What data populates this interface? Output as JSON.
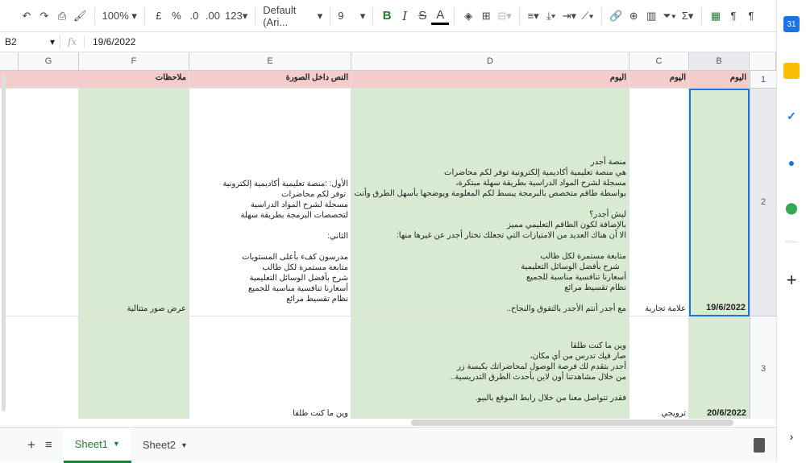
{
  "toolbar": {
    "zoom": "100%",
    "currency": "£",
    "percent": "%",
    "dec_less": ".0",
    "dec_more": ".00",
    "format": "123",
    "font": "Default (Ari...",
    "size": "9",
    "bold": "B",
    "italic": "I",
    "strike": "S",
    "textcolor": "A"
  },
  "formula": {
    "cell": "B2",
    "fx": "fx",
    "value": "19/6/2022"
  },
  "columns": [
    "G",
    "F",
    "E",
    "D",
    "C",
    "B"
  ],
  "rows": [
    "1",
    "2",
    "3"
  ],
  "header": {
    "F": "ملاحظات",
    "E": "النص داخل الصورة",
    "D": "اليوم",
    "C": "اليوم",
    "B": "اليوم"
  },
  "row2": {
    "B": "19/6/2022",
    "C": "علامة تجارية",
    "D": "منصة أجدر\nهي منصة تعليمية أكاديمية إلكترونية توفر لكم محاضرات\nمسجلة لشرح المواد الدراسية بطريقة سهلة مبتكرة،\nبواسطة طاقم متخصص بالبرمجة يبسط لكم المعلومة ويوضحها بأسهل الطرق وأنت في مكانك.\n\nليش أجدر؟\nبالإضافة لكون الطاقم التعليمي مميز\nالا أن هناك العديد من الامتيازات التي تجعلك تختار أجدر عن غيرها منها:\n\nمتابعة مستمرة لكل طالب\n   شرح بأفضل الوسائل التعليمية\nأسعارنا تنافسية مناسبة للجميع\nنظام تقسيط مرائع\n\nمع أجدر أنتم الأجدر بالتفوق والنجاح..",
    "E": "الأول: :منصة تعليمية أكاديمية إلكترونية\n توفر لكم محاضرات\nمسجلة لشرح المواد الدراسية\nلتخصصات البرمجة بطريقة سهلة\n\nالثاني:\n\nمدرسون كفء بأعلى المستويات\nمتابعة مستمرة لكل طالب\nشرح بأفضل الوسائل التعليمية\nأسعارنا تنافسية مناسبة للجميع\nنظام تقسيط مرائع",
    "F": "عرض صور متتالية"
  },
  "row3": {
    "B": "20/6/2022",
    "C": "ترويجي",
    "D": "وين ما كنت طلقا\nصار فيك تدرس من أي مكان،\nأجدر بتقدم لك فرصة الوصول لمحاضراتك بكبسة زر\nمن خلال مشاهدتنا أون لاين بأحدث الطرق التدريسية..\n\nفقدر تتواصل معنا من خلال رابط الموقع بالبيو.",
    "E": "وين ما كنت طلقا"
  },
  "sheets": [
    "Sheet1",
    "Sheet2"
  ],
  "colors": {
    "pink": "#f4cccc",
    "green": "#d9ead3",
    "accent": "#188038",
    "select": "#1a73e8"
  }
}
